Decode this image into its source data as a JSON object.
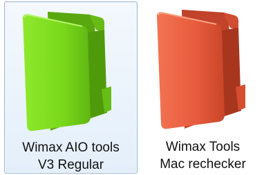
{
  "items": [
    {
      "line1": "Wimax AIO tools",
      "line2": "V3 Regular",
      "selected": true,
      "folder_color": "#73d117",
      "folder_light": "#8ce629",
      "folder_dark": "#4f9a0a"
    },
    {
      "line1": "Wimax Tools",
      "line2": "Mac rechecker",
      "selected": false,
      "folder_color": "#e55a3b",
      "folder_light": "#f06e4e",
      "folder_dark": "#a8361f"
    }
  ]
}
